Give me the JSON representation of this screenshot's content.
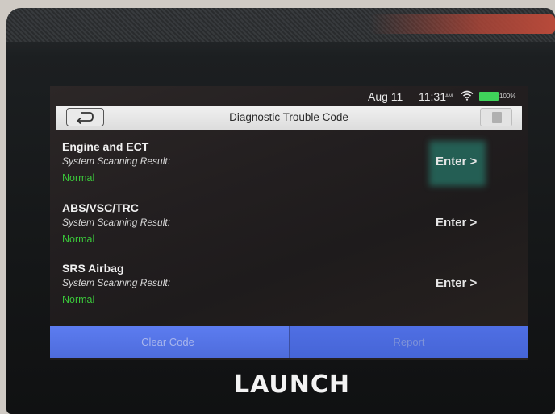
{
  "status_bar": {
    "date": "Aug 11",
    "time": "11:31",
    "ampm": "AM",
    "battery": "100%",
    "battery_color": "#3fd35a"
  },
  "header": {
    "title": "Diagnostic Trouble Code",
    "back_icon": "back-arrow-icon",
    "exit_icon": "exit-door-icon"
  },
  "systems": [
    {
      "name": "Engine and ECT",
      "scan_label": "System Scanning Result:",
      "status": "Normal",
      "action": "Enter >"
    },
    {
      "name": "ABS/VSC/TRC",
      "scan_label": "System Scanning Result:",
      "status": "Normal",
      "action": "Enter >"
    },
    {
      "name": "SRS Airbag",
      "scan_label": "System Scanning Result:",
      "status": "Normal",
      "action": "Enter >"
    }
  ],
  "footer": {
    "clear_code": "Clear Code",
    "report": "Report",
    "accent_color": "#5470e0"
  },
  "device": {
    "brand": "LAUNCH"
  }
}
